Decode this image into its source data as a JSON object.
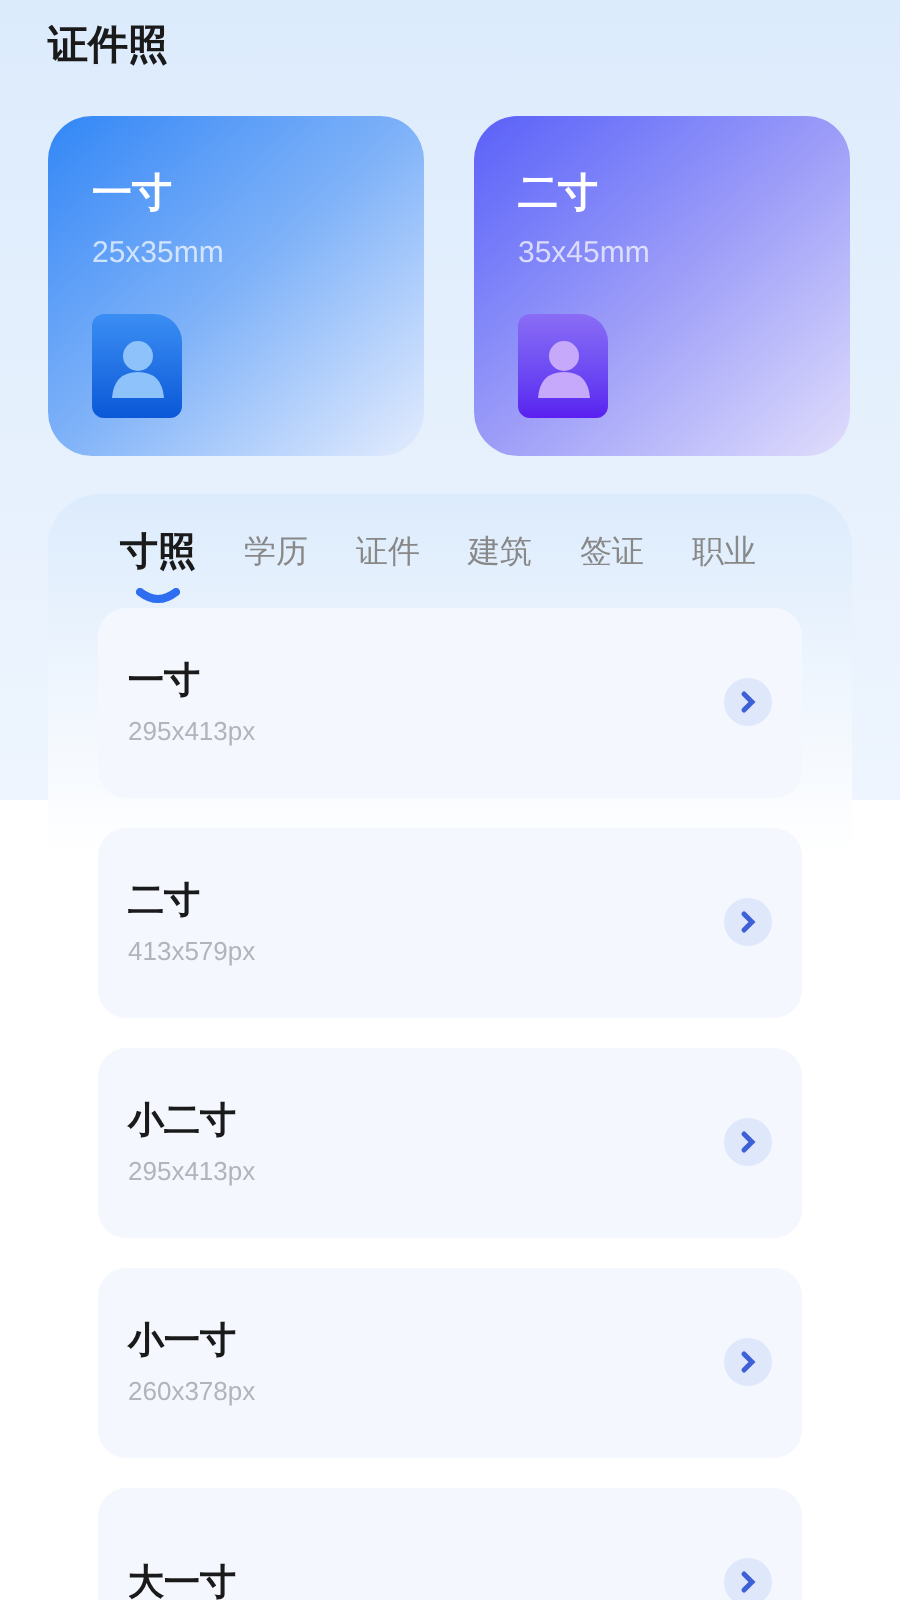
{
  "title": "证件照",
  "cards": [
    {
      "name": "一寸",
      "size": "25x35mm",
      "kind": "blue"
    },
    {
      "name": "二寸",
      "size": "35x45mm",
      "kind": "purple"
    }
  ],
  "tabs": [
    {
      "label": "寸照",
      "selected": true
    },
    {
      "label": "学历",
      "selected": false
    },
    {
      "label": "证件",
      "selected": false
    },
    {
      "label": "建筑",
      "selected": false
    },
    {
      "label": "签证",
      "selected": false
    },
    {
      "label": "职业",
      "selected": false
    }
  ],
  "items": [
    {
      "name": "一寸",
      "size": "295x413px"
    },
    {
      "name": "二寸",
      "size": "413x579px"
    },
    {
      "name": "小二寸",
      "size": "295x413px"
    },
    {
      "name": "小一寸",
      "size": "260x378px"
    },
    {
      "name": "大一寸"
    }
  ]
}
